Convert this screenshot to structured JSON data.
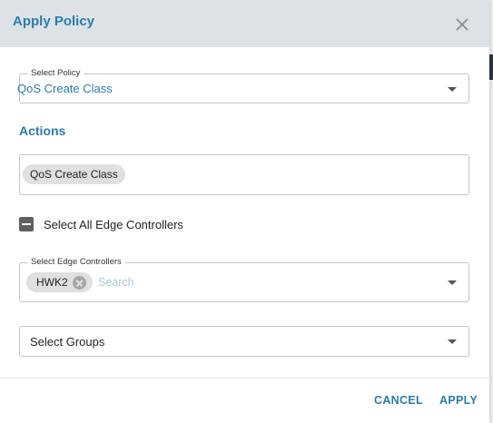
{
  "dialog": {
    "title": "Apply Policy",
    "close_icon": "close-icon"
  },
  "policy_select": {
    "label": "Select Policy",
    "value": "QoS Create Class"
  },
  "actions": {
    "title": "Actions",
    "chips": [
      "QoS Create Class"
    ]
  },
  "select_all": {
    "label": "Select All Edge Controllers",
    "state": "indeterminate"
  },
  "edge_controllers": {
    "label": "Select Edge Controllers",
    "chips": [
      "HWK2"
    ],
    "placeholder": "Search"
  },
  "groups_select": {
    "placeholder": "Select Groups"
  },
  "footer": {
    "cancel_label": "CANCEL",
    "apply_label": "APPLY"
  },
  "colors": {
    "accent": "#2c7cab",
    "header_bg": "#dde2e6",
    "chip_bg": "#e0e0e0"
  }
}
